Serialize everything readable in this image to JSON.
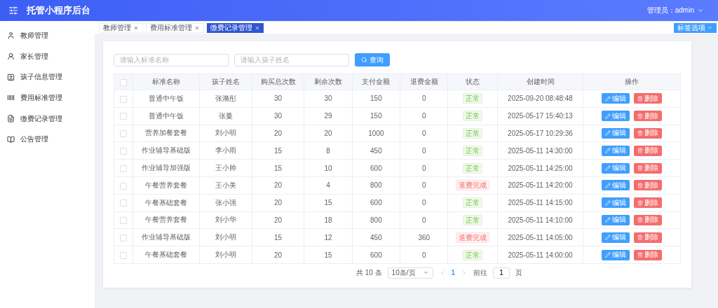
{
  "header": {
    "title": "托管小程序后台",
    "user": "管理员：admin"
  },
  "sidebar": {
    "items": [
      {
        "label": "教师管理",
        "selected": false
      },
      {
        "label": "家长管理",
        "selected": false
      },
      {
        "label": "孩子信息管理",
        "selected": false
      },
      {
        "label": "费用标准管理",
        "selected": false
      },
      {
        "label": "缴费记录管理",
        "selected": false
      },
      {
        "label": "公告管理",
        "selected": false
      }
    ]
  },
  "tabs": [
    {
      "label": "教师管理",
      "selected": false
    },
    {
      "label": "费用标准管理",
      "selected": false
    },
    {
      "label": "缴费记录管理",
      "selected": true
    }
  ],
  "tab_options_button": "标签选项",
  "search": {
    "fields": [
      {
        "placeholder": "请输入标准名称"
      },
      {
        "placeholder": "请输入孩子姓名"
      }
    ],
    "button": "查询"
  },
  "table": {
    "all_checked": false,
    "columns": [
      "标准名称",
      "孩子姓名",
      "购买总次数",
      "剩余次数",
      "支付金额",
      "退费金额",
      "状态",
      "创建时间",
      "操作"
    ],
    "rows": [
      {
        "checked": false,
        "cells": [
          "普通中午饭",
          "张漪彤",
          "30",
          "30",
          "150",
          "0"
        ],
        "status": {
          "text": "正常",
          "kind": "normal"
        },
        "created": "2025-09-20 08:48:48",
        "actions": [
          "编辑",
          "删除"
        ]
      },
      {
        "checked": false,
        "cells": [
          "普通中午饭",
          "张曼",
          "30",
          "29",
          "150",
          "0"
        ],
        "status": {
          "text": "正常",
          "kind": "normal"
        },
        "created": "2025-05-17 15:40:13",
        "actions": [
          "编辑",
          "删除"
        ]
      },
      {
        "checked": false,
        "cells": [
          "营养加餐套餐",
          "刘小明",
          "20",
          "20",
          "1000",
          "0"
        ],
        "status": {
          "text": "正常",
          "kind": "normal"
        },
        "created": "2025-05-17 10:29:36",
        "actions": [
          "编辑",
          "删除"
        ]
      },
      {
        "checked": false,
        "cells": [
          "作业辅导基础版",
          "李小雨",
          "15",
          "8",
          "450",
          "0"
        ],
        "status": {
          "text": "正常",
          "kind": "normal"
        },
        "created": "2025-05-11 14:30:00",
        "actions": [
          "编辑",
          "删除"
        ]
      },
      {
        "checked": false,
        "cells": [
          "作业辅导加强版",
          "王小帅",
          "15",
          "10",
          "600",
          "0"
        ],
        "status": {
          "text": "正常",
          "kind": "normal"
        },
        "created": "2025-05-11 14:25:00",
        "actions": [
          "编辑",
          "删除"
        ]
      },
      {
        "checked": false,
        "cells": [
          "午餐营养套餐",
          "王小美",
          "20",
          "4",
          "800",
          "0"
        ],
        "status": {
          "text": "退费完成",
          "kind": "refunded"
        },
        "created": "2025-05-11 14:20:00",
        "actions": [
          "编辑",
          "删除"
        ]
      },
      {
        "checked": false,
        "cells": [
          "午餐基础套餐",
          "张小强",
          "20",
          "15",
          "600",
          "0"
        ],
        "status": {
          "text": "正常",
          "kind": "normal"
        },
        "created": "2025-05-11 14:15:00",
        "actions": [
          "编辑",
          "删除"
        ]
      },
      {
        "checked": false,
        "cells": [
          "午餐营养套餐",
          "刘小华",
          "20",
          "18",
          "800",
          "0"
        ],
        "status": {
          "text": "正常",
          "kind": "normal"
        },
        "created": "2025-05-11 14:10:00",
        "actions": [
          "编辑",
          "删除"
        ]
      },
      {
        "checked": false,
        "cells": [
          "作业辅导基础版",
          "刘小明",
          "15",
          "12",
          "450",
          "360"
        ],
        "status": {
          "text": "退费完成",
          "kind": "refunded"
        },
        "created": "2025-05-11 14:05:00",
        "actions": [
          "编辑",
          "删除"
        ]
      },
      {
        "checked": false,
        "cells": [
          "午餐基础套餐",
          "刘小明",
          "20",
          "15",
          "600",
          "0"
        ],
        "status": {
          "text": "正常",
          "kind": "normal"
        },
        "created": "2025-05-11 14:00:00",
        "actions": [
          "编辑",
          "删除"
        ]
      }
    ]
  },
  "pagination": {
    "total": "共 10 条",
    "page_size": "10条/页",
    "pages": [
      {
        "label": "1",
        "selected": true
      }
    ],
    "goto_label": "前往",
    "goto_value": "1",
    "goto_suffix": "页"
  }
}
